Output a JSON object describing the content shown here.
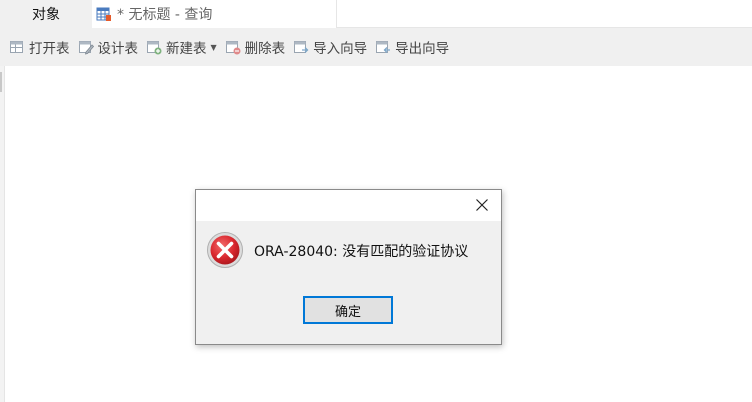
{
  "tabs": {
    "objects_label": "对象",
    "query_label": "* 无标题 - 查询"
  },
  "toolbar": {
    "open_table": "打开表",
    "design_table": "设计表",
    "new_table": "新建表",
    "delete_table": "删除表",
    "import_wizard": "导入向导",
    "export_wizard": "导出向导",
    "dropdown_glyph": "▼"
  },
  "dialog": {
    "message": "ORA-28040: 没有匹配的验证协议",
    "ok_label": "确定",
    "icon": "error-icon"
  },
  "colors": {
    "error_red": "#d9272e",
    "focus_blue": "#0078d7",
    "toolbar_bg": "#f0f0f0"
  }
}
